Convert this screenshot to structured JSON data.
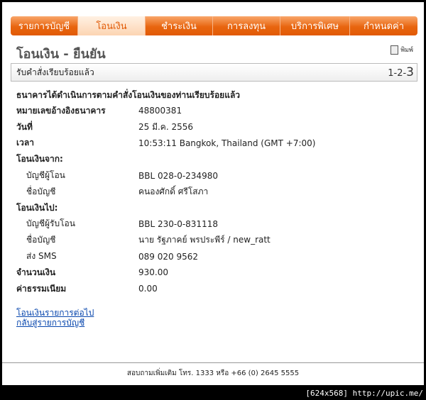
{
  "nav": {
    "items": [
      {
        "label": "รายการบัญชี"
      },
      {
        "label": "โอนเงิน"
      },
      {
        "label": "ชำระเงิน"
      },
      {
        "label": "การลงทุน"
      },
      {
        "label": "บริการพิเศษ"
      },
      {
        "label": "กำหนดค่า"
      }
    ],
    "active_index": 1
  },
  "page": {
    "title": "โอนเงิน - ยืนยัน",
    "print_label": "พิมพ์",
    "print_icon": "printer-icon"
  },
  "status_bar": {
    "label": "รับคำสั่งเรียบร้อยแล้ว",
    "steps_prefix": "1-2-",
    "steps_current": "3"
  },
  "confirmation_message": "ธนาคารได้ดำเนินการตามคำสั่งโอนเงินของท่านเรียบร้อยแล้ว",
  "details": {
    "reference_label": "หมายเลขอ้างอิงธนาคาร",
    "reference_value": "48800381",
    "date_label": "วันที่",
    "date_value": "25 มี.ค. 2556",
    "time_label": "เวลา",
    "time_value": "10:53:11 Bangkok, Thailand (GMT +7:00)",
    "from_label": "โอนเงินจาก:",
    "from_account_label": "บัญชีผู้โอน",
    "from_account_value": "BBL 028-0-234980",
    "from_name_label": "ชื่อบัญชี",
    "from_name_value": "คนองศักดิ์ ศรีโสภา",
    "to_label": "โอนเงินไป:",
    "to_account_label": "บัญชีผู้รับโอน",
    "to_account_value": "BBL 230-0-831118",
    "to_name_label": "ชื่อบัญชี",
    "to_name_value": "นาย รัฐภาคย์ พรประพีร์ / new_ratt",
    "sms_label": "ส่ง SMS",
    "sms_value": "089 020 9562",
    "amount_label": "จำนวนเงิน",
    "amount_value": "930.00",
    "fee_label": "ค่าธรรมเนียม",
    "fee_value": "0.00"
  },
  "links": {
    "next_transfer": "โอนเงินรายการต่อไป",
    "back_to_accounts": "กลับสู่รายการบัญชี"
  },
  "footer": {
    "text": "สอบถามเพิ่มเติม โทร. 1333 หรือ +66 (0) 2645 5555"
  },
  "watermark": "[624x568] http://upic.me/"
}
